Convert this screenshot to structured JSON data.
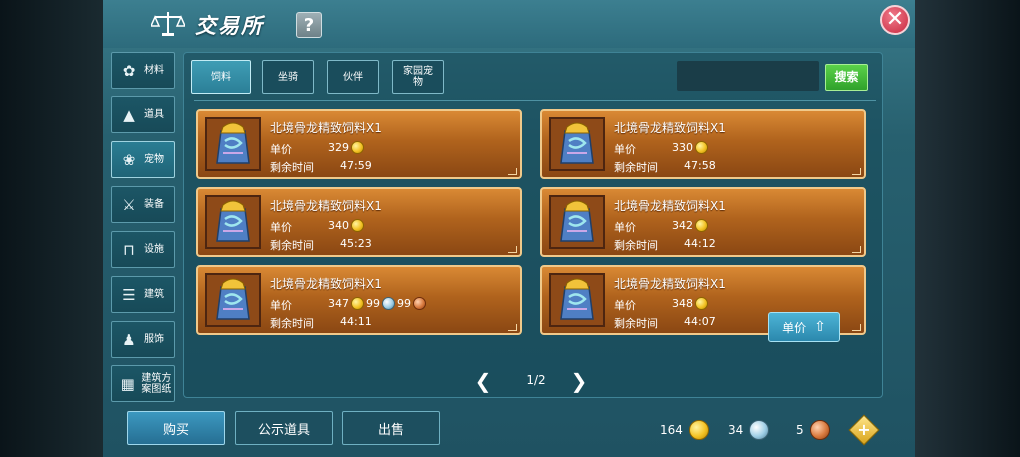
{
  "header": {
    "title": "交易所",
    "help": "?",
    "close": "✕"
  },
  "sidebar": {
    "items": [
      {
        "label": "材料",
        "icon": "flower-icon"
      },
      {
        "label": "道具",
        "icon": "flask-icon"
      },
      {
        "label": "宠物",
        "icon": "paw-icon"
      },
      {
        "label": "装备",
        "icon": "sword-icon"
      },
      {
        "label": "设施",
        "icon": "rack-icon"
      },
      {
        "label": "建筑",
        "icon": "building-icon"
      },
      {
        "label": "服饰",
        "icon": "clothing-icon"
      },
      {
        "label": "建筑方案图纸",
        "icon": "blueprint-icon"
      }
    ],
    "active": 2
  },
  "tabs": {
    "items": [
      "饲料",
      "坐骑",
      "伙伴",
      "家园宠物"
    ],
    "active": 0,
    "search_label": "搜索"
  },
  "listings": {
    "price_label": "单价",
    "time_label": "剩余时间",
    "items": [
      {
        "name": "北境骨龙精致饲料X1",
        "price": "329",
        "time": "47:59"
      },
      {
        "name": "北境骨龙精致饲料X1",
        "price": "330",
        "time": "47:58"
      },
      {
        "name": "北境骨龙精致饲料X1",
        "price": "340",
        "time": "45:23"
      },
      {
        "name": "北境骨龙精致饲料X1",
        "price": "342",
        "time": "44:12"
      },
      {
        "name": "北境骨龙精致饲料X1",
        "price": "347",
        "price_silver": "99",
        "price_bronze": "99",
        "time": "44:11"
      },
      {
        "name": "北境骨龙精致饲料X1",
        "price": "348",
        "time": "44:07"
      }
    ]
  },
  "pager": {
    "text": "1/2",
    "prev": "❮",
    "next": "❯"
  },
  "sort": {
    "label": "单价",
    "arrow": "⇧"
  },
  "bottom": {
    "buy": "购买",
    "public_items": "公示道具",
    "sell": "出售"
  },
  "currency": {
    "gold": "164",
    "silver": "34",
    "bronze": "5",
    "add": "+"
  },
  "colors": {
    "accent": "#2b7f97",
    "card": "#b0631d",
    "search": "#2fa12b",
    "close": "#c8283f"
  }
}
